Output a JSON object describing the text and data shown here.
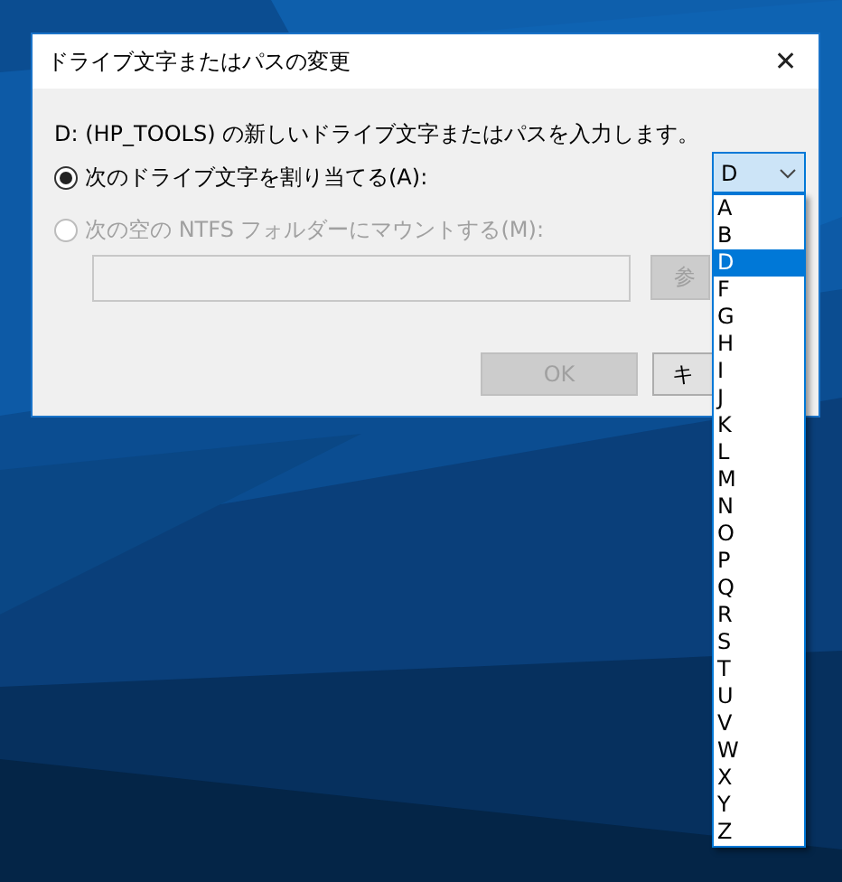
{
  "window": {
    "title": "ドライブ文字またはパスの変更",
    "close": "✕"
  },
  "description": "D: (HP_TOOLS) の新しいドライブ文字またはパスを入力します。",
  "options": [
    {
      "label": "次のドライブ文字を割り当てる(A):",
      "selected": true,
      "disabled": false
    },
    {
      "label": "次の空の NTFS フォルダーにマウントする(M):",
      "selected": false,
      "disabled": true
    }
  ],
  "drive_combo": {
    "value": "D"
  },
  "path_field": {
    "disabled": true
  },
  "browse_button": {
    "label": "参",
    "disabled": true
  },
  "buttons": [
    {
      "label": "OK",
      "disabled": true
    },
    {
      "label": "キ",
      "disabled": false
    }
  ],
  "drive_list": [
    {
      "label": "A",
      "selected": false
    },
    {
      "label": "B",
      "selected": false
    },
    {
      "label": "D",
      "selected": true
    },
    {
      "label": "F",
      "selected": false
    },
    {
      "label": "G",
      "selected": false
    },
    {
      "label": "H",
      "selected": false
    },
    {
      "label": "I",
      "selected": false
    },
    {
      "label": "J",
      "selected": false
    },
    {
      "label": "K",
      "selected": false
    },
    {
      "label": "L",
      "selected": false
    },
    {
      "label": "M",
      "selected": false
    },
    {
      "label": "N",
      "selected": false
    },
    {
      "label": "O",
      "selected": false
    },
    {
      "label": "P",
      "selected": false
    },
    {
      "label": "Q",
      "selected": false
    },
    {
      "label": "R",
      "selected": false
    },
    {
      "label": "S",
      "selected": false
    },
    {
      "label": "T",
      "selected": false
    },
    {
      "label": "U",
      "selected": false
    },
    {
      "label": "V",
      "selected": false
    },
    {
      "label": "W",
      "selected": false
    },
    {
      "label": "X",
      "selected": false
    },
    {
      "label": "Y",
      "selected": false
    },
    {
      "label": "Z",
      "selected": false
    }
  ]
}
